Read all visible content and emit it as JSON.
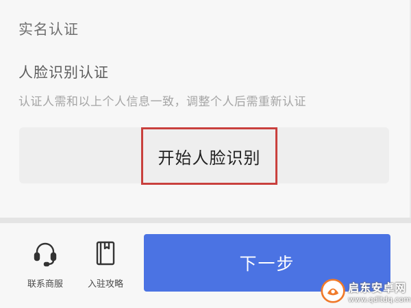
{
  "verification": {
    "section_title": "实名认证",
    "face_title": "人脸识别认证",
    "face_description": "认证人需和以上个人信息一致，调整个人后需重新认证",
    "start_button_label": "开始人脸识别"
  },
  "bottom_bar": {
    "contact": {
      "label": "联系商服",
      "icon": "headset-icon"
    },
    "guide": {
      "label": "入驻攻略",
      "icon": "book-icon"
    },
    "next_button_label": "下一步"
  },
  "watermark": {
    "title": "启东安卓网",
    "url": "www.qdltdq.com"
  },
  "colors": {
    "accent_blue": "#4b73e3",
    "highlight_red": "#c9403d",
    "watermark_orange": "#f07a2a"
  }
}
